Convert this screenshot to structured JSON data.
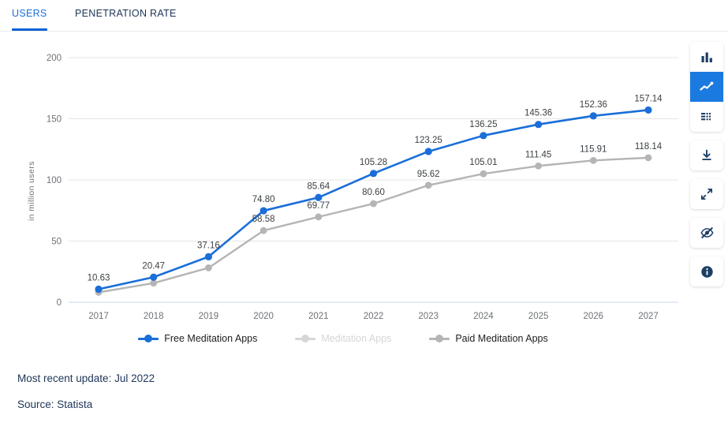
{
  "tabs": [
    {
      "label": "USERS",
      "active": true
    },
    {
      "label": "PENETRATION RATE",
      "active": false
    }
  ],
  "footer": {
    "update": "Most recent update: Jul 2022",
    "source": "Source: Statista"
  },
  "toolbar": {
    "items": [
      {
        "name": "bar-chart-icon",
        "label": "Bar chart view",
        "active": false
      },
      {
        "name": "line-chart-icon",
        "label": "Line chart view",
        "active": true
      },
      {
        "name": "table-icon",
        "label": "Table view",
        "active": false
      },
      {
        "name": "download-icon",
        "label": "Download",
        "active": false
      },
      {
        "name": "expand-icon",
        "label": "Fullscreen",
        "active": false
      },
      {
        "name": "eye-off-icon",
        "label": "Hide",
        "active": false
      },
      {
        "name": "info-icon",
        "label": "Info",
        "active": false
      }
    ]
  },
  "colors": {
    "blue": "#1a6ed8",
    "grey": "#b5b5b5",
    "grid": "#e4e5e7",
    "zero": "#c9d6ec",
    "label": "#3c4043",
    "tick": "#6f7276",
    "accent_tab": "#0b63d6",
    "toolbar_icon": "#1d3f66",
    "muted_legend": "#d4d6d8"
  },
  "chart_data": {
    "type": "line",
    "title": "",
    "xlabel": "",
    "ylabel": "in million users",
    "categories": [
      "2017",
      "2018",
      "2019",
      "2020",
      "2021",
      "2022",
      "2023",
      "2024",
      "2025",
      "2026",
      "2027"
    ],
    "ylim": [
      0,
      200
    ],
    "yticks": [
      0,
      50,
      100,
      150,
      200
    ],
    "grid": true,
    "legend_position": "bottom",
    "series": [
      {
        "name": "Free Meditation Apps",
        "color": "#1a6ed8",
        "active": true,
        "values": [
          10.63,
          20.47,
          37.16,
          74.8,
          85.64,
          105.28,
          123.25,
          136.25,
          145.36,
          152.36,
          157.14
        ],
        "labels": [
          "10.63",
          "20.47",
          "37.16",
          "74.80",
          "85.64",
          "105.28",
          "123.25",
          "136.25",
          "145.36",
          "152.36",
          "157.14"
        ]
      },
      {
        "name": "Meditation Apps",
        "color": "#d4d6d8",
        "active": false,
        "values": [],
        "labels": []
      },
      {
        "name": "Paid Meditation Apps",
        "color": "#b5b5b5",
        "active": true,
        "values": [
          8.1,
          15.6,
          28.1,
          58.58,
          69.77,
          80.6,
          95.62,
          105.01,
          111.45,
          115.91,
          118.14
        ],
        "labels": [
          "",
          "",
          "",
          "58.58",
          "69.77",
          "80.60",
          "95.62",
          "105.01",
          "111.45",
          "115.91",
          "118.14"
        ]
      }
    ]
  }
}
